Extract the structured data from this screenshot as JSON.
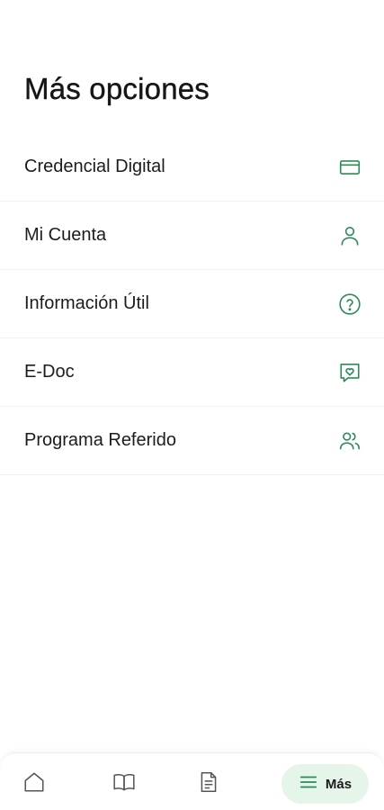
{
  "header": {
    "title": "Más opciones"
  },
  "options": [
    {
      "label": "Credencial Digital",
      "icon": "credit-card-icon"
    },
    {
      "label": "Mi Cuenta",
      "icon": "user-icon"
    },
    {
      "label": "Información Útil",
      "icon": "help-circle-icon"
    },
    {
      "label": "E-Doc",
      "icon": "heart-chat-icon"
    },
    {
      "label": "Programa Referido",
      "icon": "users-icon"
    }
  ],
  "bottom_nav": {
    "items": [
      {
        "icon": "home-icon"
      },
      {
        "icon": "book-icon"
      },
      {
        "icon": "document-icon"
      },
      {
        "icon": "menu-icon",
        "label": "Más",
        "active": true
      }
    ]
  },
  "colors": {
    "accent": "#2e8b57",
    "active_bg": "#e6f5e9",
    "icon_gray": "#555555"
  }
}
